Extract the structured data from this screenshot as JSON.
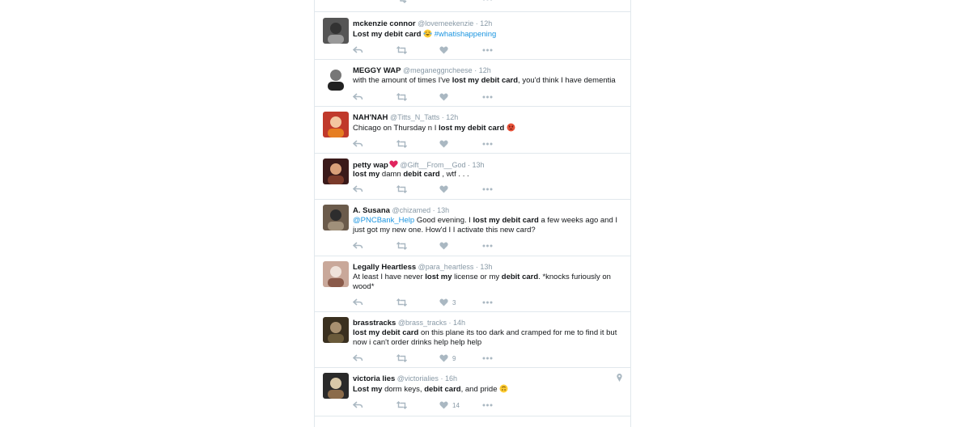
{
  "colors": {
    "link": "#1b95e0",
    "name": "#14171a",
    "meta": "#8899a6",
    "action": "#aab8c2",
    "border": "#e1e8ed"
  },
  "tweets": [
    {
      "name": "mckenzie connor",
      "handle": "@lovemeekenzie",
      "time": "12h",
      "segments": [
        {
          "t": "Lost my debit card",
          "b": true
        },
        {
          "t": " "
        },
        {
          "emoji": "joy"
        },
        {
          "t": " "
        },
        {
          "t": "#whatishappening",
          "link": true
        }
      ],
      "likes": ""
    },
    {
      "name": "MEGGY WAP",
      "handle": "@meganeggncheese",
      "time": "12h",
      "segments": [
        {
          "t": "with the amount of times I've "
        },
        {
          "t": "lost my debit card",
          "b": true
        },
        {
          "t": ", you'd think I have dementia"
        }
      ],
      "likes": ""
    },
    {
      "name": "NAH'NAH",
      "handle": "@Titts_N_Tatts",
      "time": "12h",
      "segments": [
        {
          "t": "Chicago on Thursday n I "
        },
        {
          "t": "lost my debit card",
          "b": true
        },
        {
          "t": " "
        },
        {
          "emoji": "angry"
        }
      ],
      "likes": ""
    },
    {
      "name": "petty wap",
      "handle": "@Gift__From__God",
      "time": "13h",
      "name_heart": true,
      "segments": [
        {
          "t": "lost my",
          "b": true
        },
        {
          "t": " damn "
        },
        {
          "t": "debit card",
          "b": true
        },
        {
          "t": " , wtf . . ."
        }
      ],
      "likes": ""
    },
    {
      "name": "A. Susana",
      "handle": "@chizamed",
      "time": "13h",
      "segments": [
        {
          "t": "@PNCBank_Help",
          "link": true
        },
        {
          "t": " Good evening. I "
        },
        {
          "t": "lost my debit card",
          "b": true
        },
        {
          "t": " a few weeks ago and I just got my new one. How'd I I activate this new card?"
        }
      ],
      "likes": ""
    },
    {
      "name": "Legally Heartless",
      "handle": "@para_heartless",
      "time": "13h",
      "segments": [
        {
          "t": "At least I have never "
        },
        {
          "t": "lost my",
          "b": true
        },
        {
          "t": " license or my "
        },
        {
          "t": "debit card",
          "b": true
        },
        {
          "t": ". *knocks furiously on wood*"
        }
      ],
      "likes": "3"
    },
    {
      "name": "brasstracks",
      "handle": "@brass_tracks",
      "time": "14h",
      "segments": [
        {
          "t": "lost my debit card",
          "b": true
        },
        {
          "t": " on this plane its too dark and cramped for me to find it but now i can't order drinks help help help"
        }
      ],
      "likes": "9"
    },
    {
      "name": "victoria lies",
      "handle": "@victorialies",
      "time": "16h",
      "pin": true,
      "segments": [
        {
          "t": "Lost my",
          "b": true
        },
        {
          "t": " dorm keys, "
        },
        {
          "t": "debit card",
          "b": true
        },
        {
          "t": ", and pride "
        },
        {
          "emoji": "upside"
        }
      ],
      "likes": "14"
    }
  ],
  "icons": {
    "reply": "reply-icon",
    "retweet": "retweet-icon",
    "like": "heart-icon",
    "more": "more-icon",
    "location": "location-pin-icon",
    "name_heart": "red-heart-icon"
  },
  "separator": "·"
}
